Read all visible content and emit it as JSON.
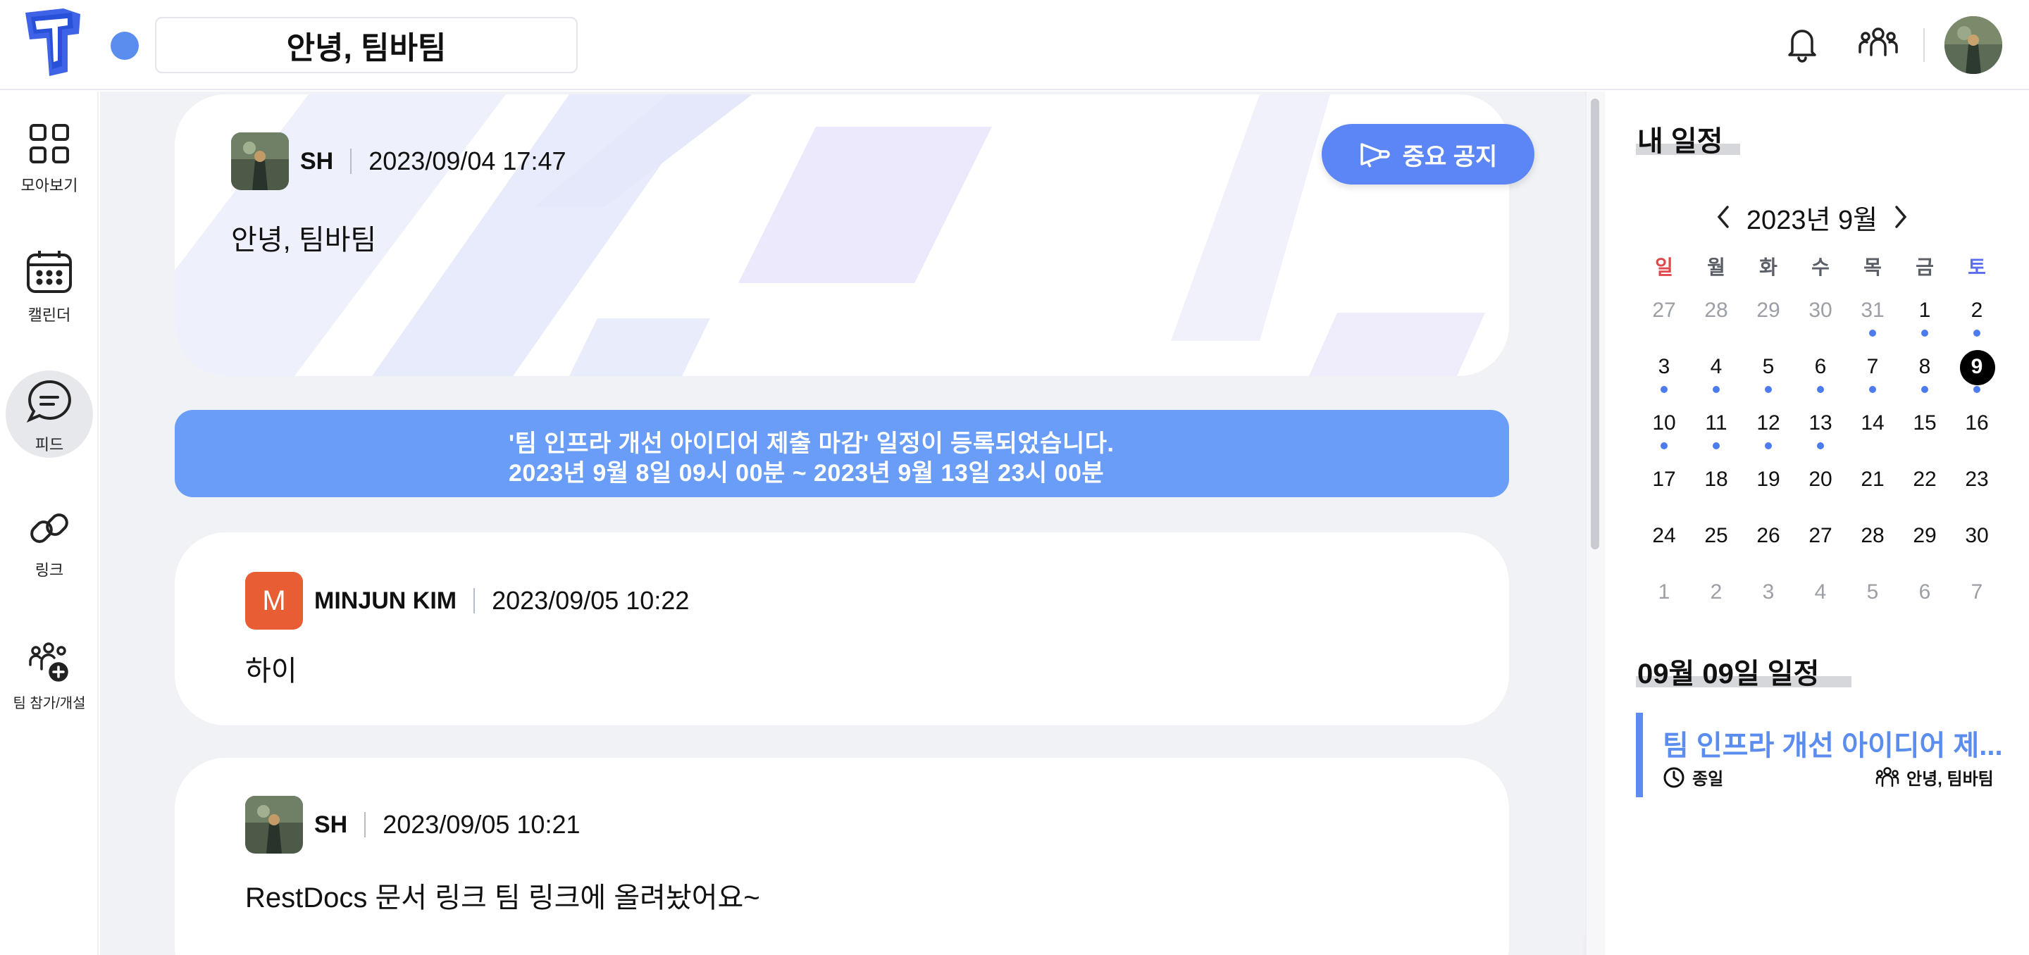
{
  "header": {
    "team_name": "안녕, 팀바팀"
  },
  "sidenav": {
    "items": [
      {
        "label": "모아보기",
        "icon": "grid-icon"
      },
      {
        "label": "캘린더",
        "icon": "calendar-icon"
      },
      {
        "label": "피드",
        "icon": "chat-icon",
        "active": true
      },
      {
        "label": "링크",
        "icon": "link-icon"
      },
      {
        "label": "팀 참가/개설",
        "icon": "team-add-icon"
      }
    ]
  },
  "feed": {
    "notice": {
      "author": "SH",
      "date": "2023/09/04 17:47",
      "body": "안녕, 팀바팀",
      "badge_label": "중요 공지"
    },
    "event_banner": {
      "line1": "'팀 인프라 개선 아이디어 제출 마감' 일정이 등록되었습니다.",
      "line2": "2023년 9월 8일 09시 00분 ~ 2023년 9월 13일 23시 00분"
    },
    "posts": [
      {
        "author": "MINJUN KIM",
        "avatar_letter": "M",
        "date": "2023/09/05 10:22",
        "body": "하이"
      },
      {
        "author": "SH",
        "date": "2023/09/05 10:21",
        "body": "RestDocs 문서 링크 팀 링크에 올려놨어요~"
      }
    ]
  },
  "schedule": {
    "title": "내 일정",
    "month_label": "2023년 9월",
    "weekdays": [
      "일",
      "월",
      "화",
      "수",
      "목",
      "금",
      "토"
    ],
    "weeks": [
      [
        "27",
        "28",
        "29",
        "30",
        "31",
        "1",
        "2"
      ],
      [
        "3",
        "4",
        "5",
        "6",
        "7",
        "8",
        "9"
      ],
      [
        "10",
        "11",
        "12",
        "13",
        "14",
        "15",
        "16"
      ],
      [
        "17",
        "18",
        "19",
        "20",
        "21",
        "22",
        "23"
      ],
      [
        "24",
        "25",
        "26",
        "27",
        "28",
        "29",
        "30"
      ],
      [
        "1",
        "2",
        "3",
        "4",
        "5",
        "6",
        "7"
      ]
    ],
    "selected_day": "9",
    "day_title": "09월 09일 일정",
    "events": [
      {
        "title": "팀 인프라 개선 아이디어 제...",
        "time": "종일",
        "team": "안녕, 팀바팀"
      }
    ]
  },
  "colors": {
    "accent": "#5b8def",
    "notice_button": "#5c85f5",
    "banner": "#699df7",
    "sunday": "#e0484c",
    "saturday": "#5b6ef0",
    "weekday": "#5a5e66",
    "avatar_orange": "#e85d33"
  }
}
